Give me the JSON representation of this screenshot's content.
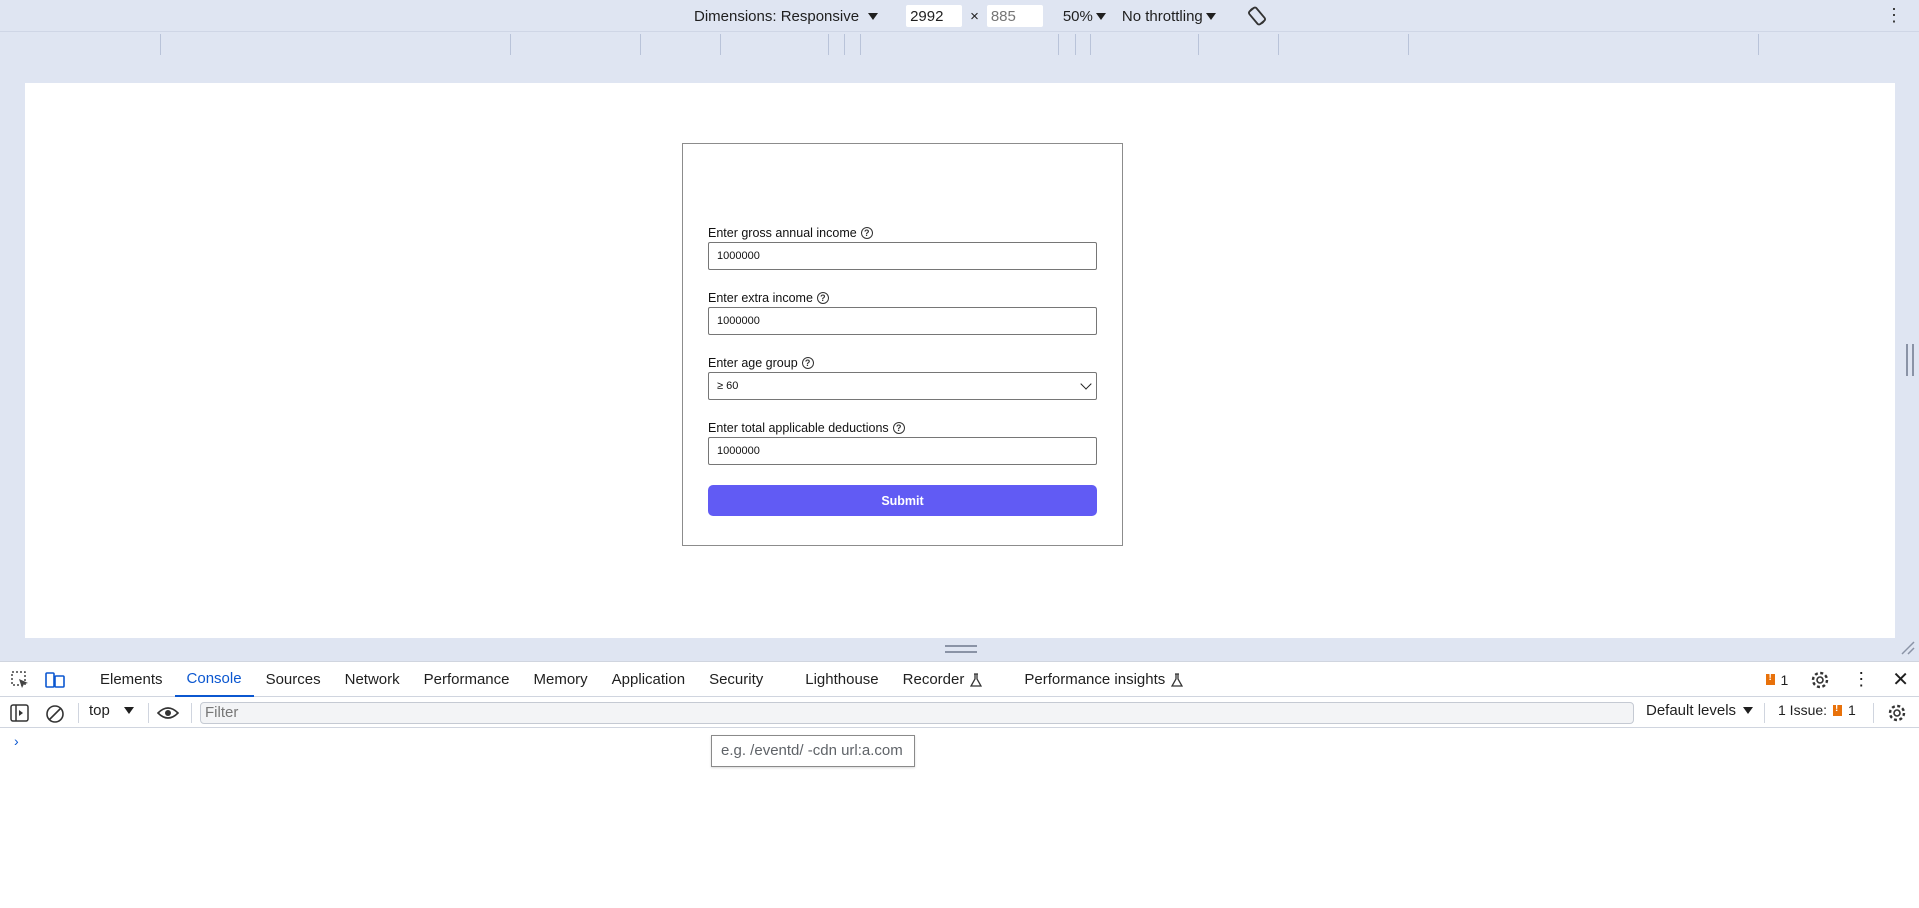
{
  "device_toolbar": {
    "dimensions_label": "Dimensions: Responsive",
    "width_value": "2992",
    "height_placeholder": "885",
    "times_sign": "×",
    "zoom": "50%",
    "throttling": "No throttling",
    "rotate_icon": "rotate-icon",
    "more_icon": "kebab-icon"
  },
  "form": {
    "fields": [
      {
        "label": "Enter gross annual income",
        "value": "1000000",
        "help_icon": "?"
      },
      {
        "label": "Enter extra income",
        "value": "1000000",
        "help_icon": "?"
      },
      {
        "label": "Enter age group",
        "value": "≥ 60",
        "help_icon": "?"
      },
      {
        "label": "Enter total applicable deductions",
        "value": "1000000",
        "help_icon": "?"
      }
    ],
    "submit_label": "Submit",
    "accent_color": "#615bf4"
  },
  "devtools": {
    "tabs": [
      {
        "label": "Elements"
      },
      {
        "label": "Console"
      },
      {
        "label": "Sources"
      },
      {
        "label": "Network"
      },
      {
        "label": "Performance"
      },
      {
        "label": "Memory"
      },
      {
        "label": "Application"
      },
      {
        "label": "Security"
      },
      {
        "label": "Lighthouse"
      },
      {
        "label": "Recorder"
      },
      {
        "label": "Performance insights"
      }
    ],
    "active_tab": "Console",
    "issues_count": "1",
    "console": {
      "context": "top",
      "filter_placeholder": "Filter",
      "levels": "Default levels",
      "issues_label": "1 Issue:",
      "issues_count": "1",
      "prompt": "›",
      "filter_hint": "e.g. /eventd/ -cdn url:a.com"
    }
  }
}
